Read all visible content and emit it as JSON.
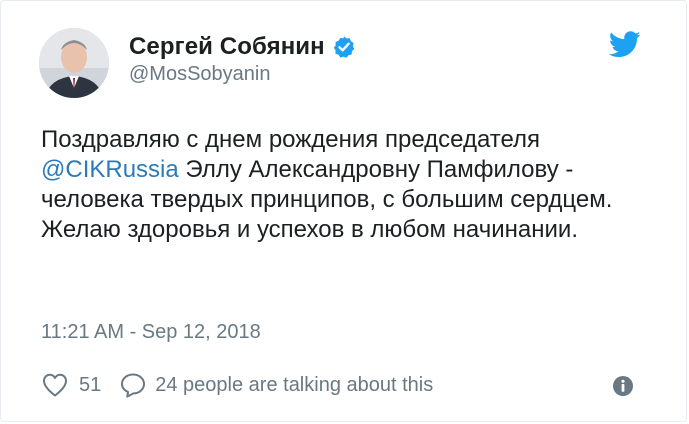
{
  "author": {
    "display_name": "Сергей Собянин",
    "handle": "@MosSobyanin",
    "verified": true,
    "avatar_icon": "avatar-portrait"
  },
  "tweet": {
    "text_before_mention": "Поздравляю с днем рождения председателя ",
    "mention": "@CIKRussia",
    "text_after_mention": " Эллу Александровну Памфилову - человека твердых принципов, с большим сердцем. Желаю здоровья и успехов в любом начинании.",
    "timestamp": "11:21 AM - Sep 12, 2018"
  },
  "actions": {
    "like_count": "51",
    "talking_text": "24 people are talking about this"
  },
  "icons": {
    "brand": "twitter-bird-icon",
    "verified": "verified-badge-icon",
    "like": "heart-icon",
    "reply": "speech-bubble-icon",
    "info": "info-icon"
  },
  "colors": {
    "brand": "#1da1f2",
    "link": "#2b7bb9",
    "secondary_text": "#697882",
    "primary_text": "#1c2022"
  }
}
